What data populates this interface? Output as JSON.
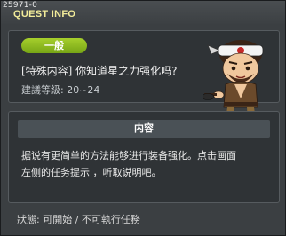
{
  "window": {
    "quest_id": "25971-0",
    "title": "QUEST INFO"
  },
  "quest": {
    "category_badge": "一般",
    "title": "[特殊内容] 你知道星之力强化吗?",
    "level_label": "建議等級: 20~24"
  },
  "content": {
    "header": "内容",
    "description_line1": "据说有更简单的方法能够进行装备强化。点击画面",
    "description_line2": "左侧的任务提示 ，听取说明吧。"
  },
  "status": {
    "text": "狀態: 可開始 / 不可執行任務"
  },
  "colors": {
    "title": "#f2ec9a",
    "badge": "#8fbe1f",
    "panel_bg": "#2f3336",
    "window_bg": "#3b3f42"
  }
}
